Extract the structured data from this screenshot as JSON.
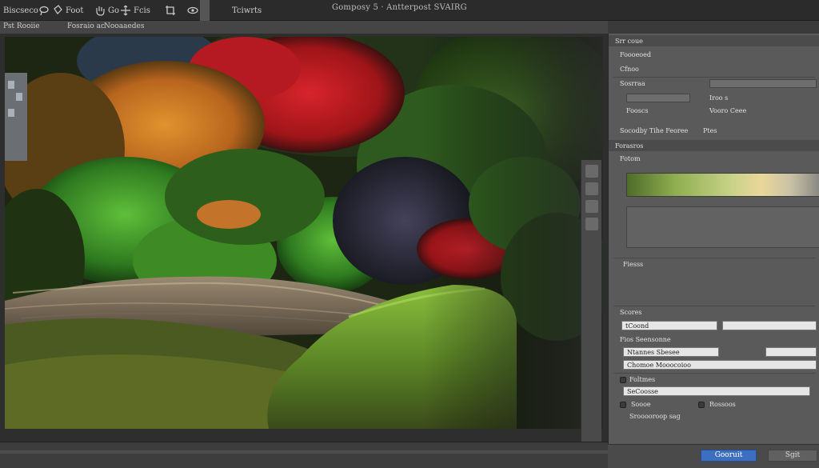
{
  "topbar": {
    "items": [
      {
        "label": "Biscseco",
        "icon": "brush-icon"
      },
      {
        "label": "Foot",
        "icon": "lasso-icon"
      },
      {
        "label": "Go",
        "icon": "hand-icon"
      },
      {
        "label": "Fcis",
        "icon": "move-icon"
      },
      {
        "label": "",
        "icon": "crop-icon"
      },
      {
        "label": "",
        "icon": "eye-icon"
      },
      {
        "label": "Tciwrts",
        "icon": ""
      }
    ],
    "title": "Gomposy 5 · Antterpost SVAIRG"
  },
  "optbar": {
    "item1": "Pst Rooiie",
    "item2": "Fosraio ac",
    "item3": "Nooaaedes"
  },
  "panel": {
    "row1": "Srr coue",
    "row2": "Foooeoed",
    "row3": "Cfnoo",
    "row4": "Sosrraa",
    "row5": "Socodby Tihe Feoree",
    "row5b": "Ptes",
    "row6": "Forasros",
    "row6b": "Iroo s",
    "row7": "Fooscs",
    "row8": "Vooro Ceee",
    "row9": "Fotom",
    "row10": "Fiesss",
    "row11": "Scores",
    "input1": "tCoond",
    "row12": "Fios Seensonne",
    "input2": "Ntannes Sbesee",
    "input3": "Chomoe Mooocoioo",
    "row13": "Foltmes",
    "input4": "SeCoosse",
    "row14": "Soooe",
    "row14b": "Rossoos",
    "row15": "Srooooroop sag"
  },
  "buttons": {
    "primary": "Gooruit",
    "secondary": "Sgit"
  },
  "colors": {
    "accent": "#3d6fc0",
    "panel": "#5a5a5a",
    "toolbar": "#2b2b2b"
  }
}
